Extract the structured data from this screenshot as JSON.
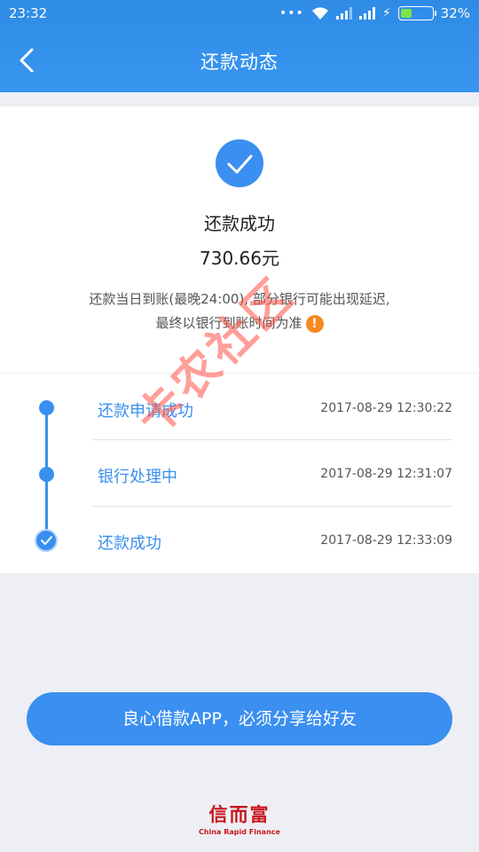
{
  "status_bar": {
    "time": "23:32",
    "battery": "32%"
  },
  "nav": {
    "title": "还款动态"
  },
  "result": {
    "title": "还款成功",
    "amount": "730.66元",
    "note_line1": "还款当日到账(最晚24:00), 部分银行可能出现延迟,",
    "note_line2": "最终以银行到账时间为准",
    "warn_glyph": "!"
  },
  "timeline": [
    {
      "label": "还款申请成功",
      "time": "2017-08-29 12:30:22"
    },
    {
      "label": "银行处理中",
      "time": "2017-08-29 12:31:07"
    },
    {
      "label": "还款成功",
      "time": "2017-08-29 12:33:09"
    }
  ],
  "share_button": "良心借款APP，必须分享给好友",
  "logo": {
    "cn": "信而富",
    "en": "China Rapid Finance"
  },
  "watermark": "卡农社区",
  "colors": {
    "primary": "#3a8ff0",
    "warn": "#f58a1f",
    "logo": "#c8161d"
  }
}
